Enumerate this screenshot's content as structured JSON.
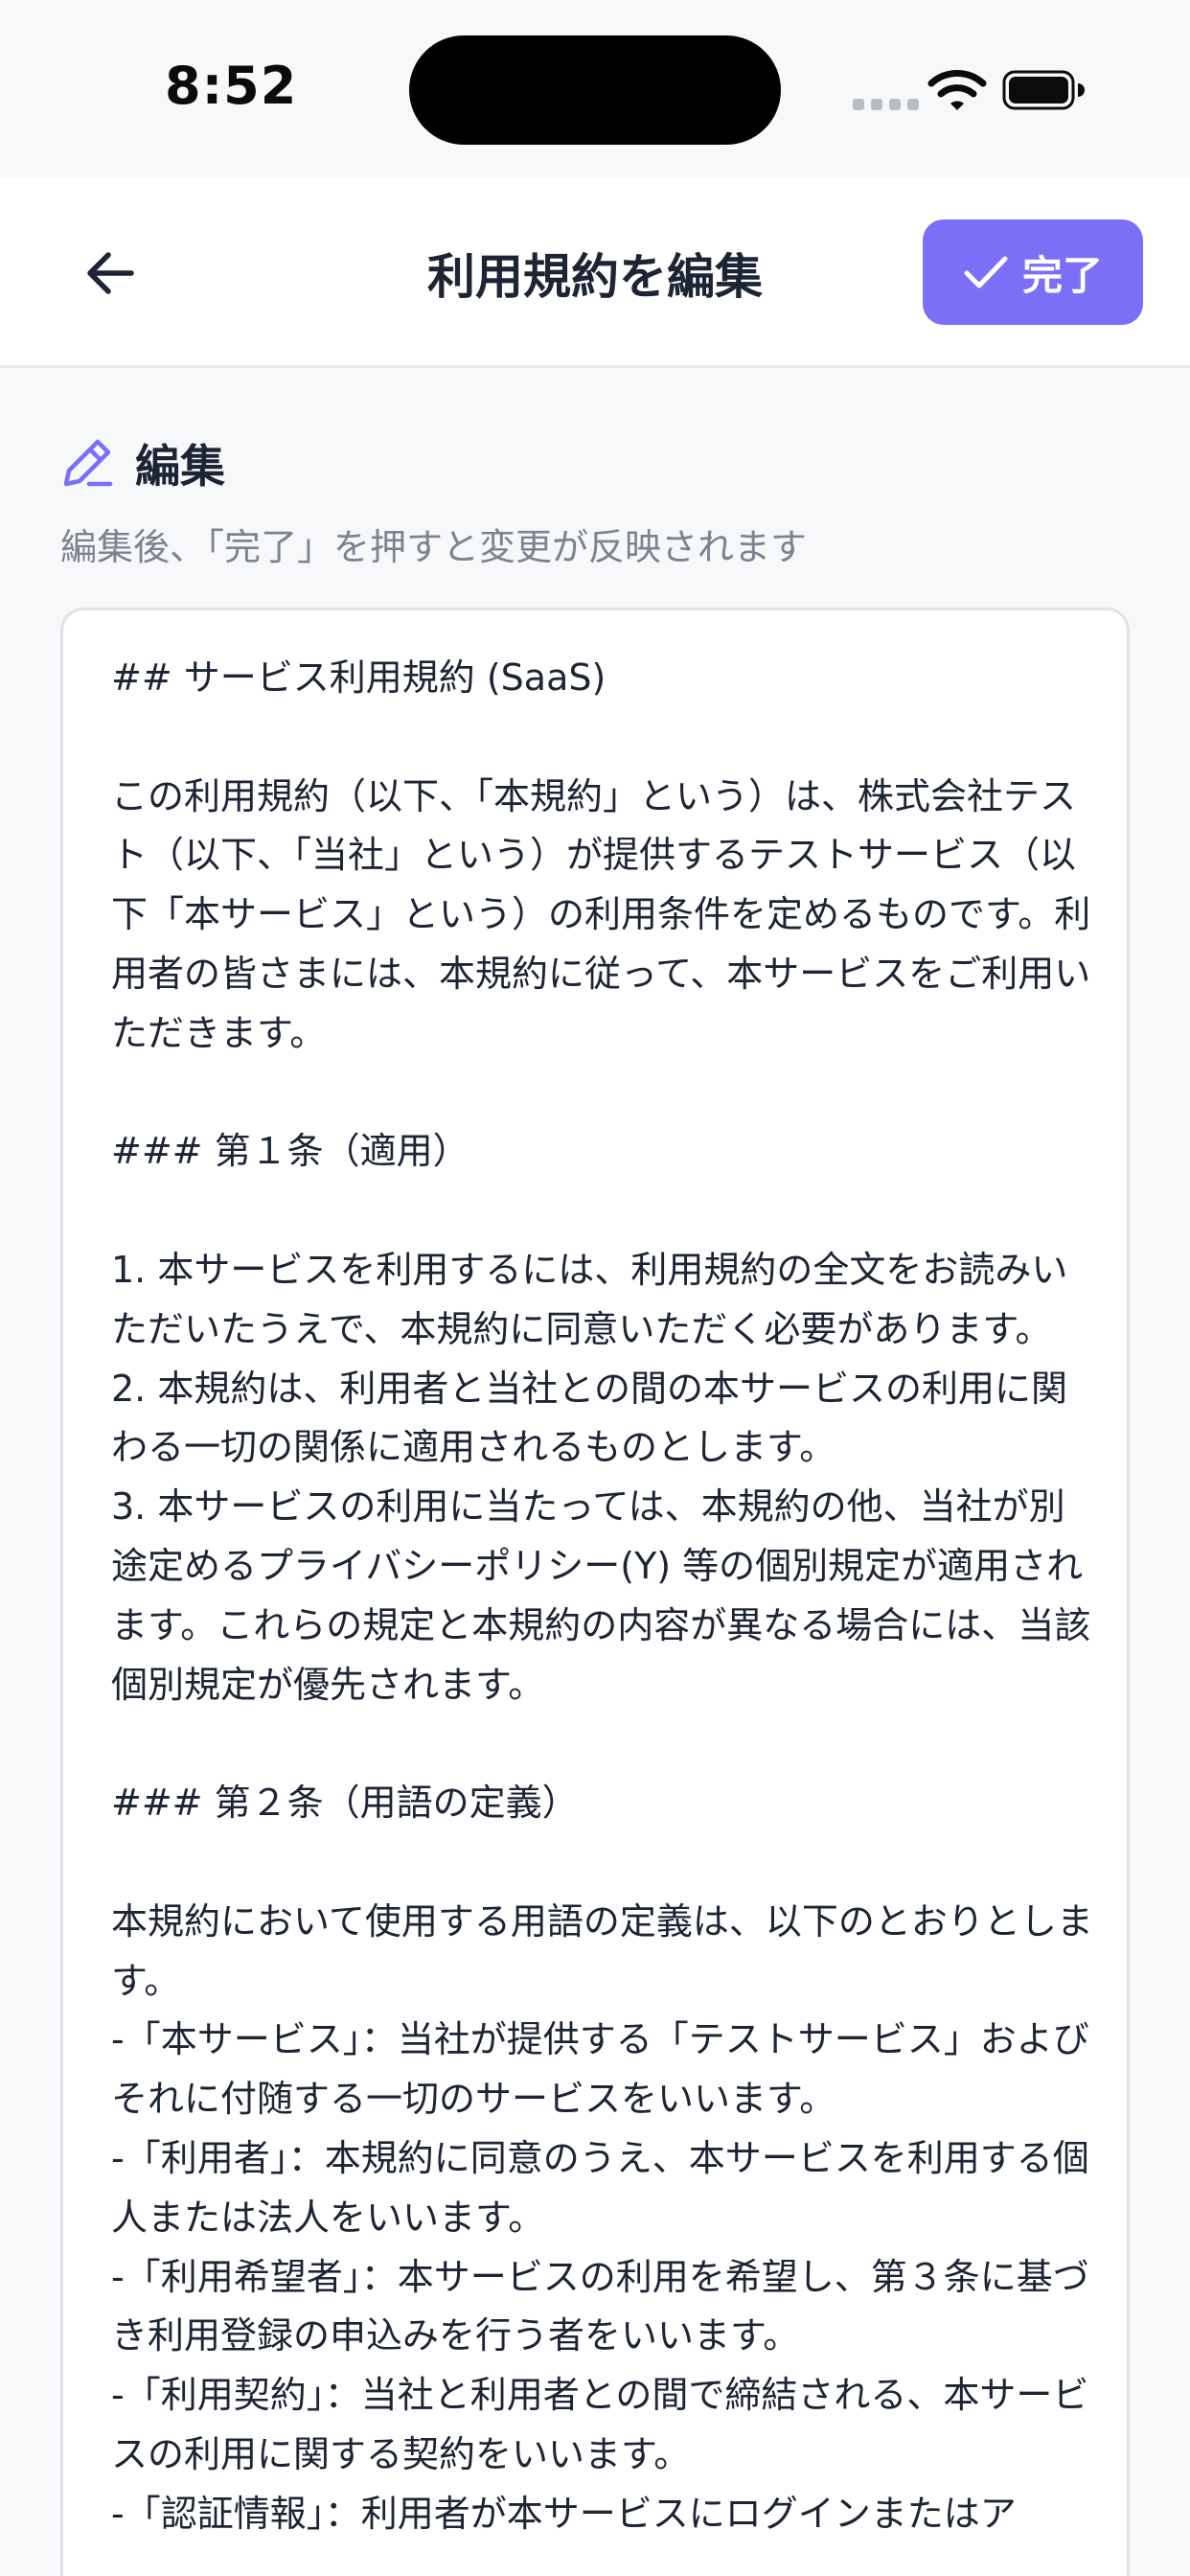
{
  "status_bar": {
    "time": "8:52"
  },
  "header": {
    "title": "利用規約を編集",
    "done_label": "完了"
  },
  "section": {
    "title": "編集",
    "hint": "編集後、「完了」を押すと変更が反映されます"
  },
  "editor": {
    "content": "## サービス利用規約 (SaaS)\n\nこの利用規約（以下、「本規約」という）は、株式会社テスト（以下、「当社」という）が提供するテストサービス（以下「本サービス」という）の利用条件を定めるものです。利用者の皆さまには、本規約に従って、本サービスをご利用いただきます。\n\n### 第１条（適用）\n\n1. 本サービスを利用するには、利用規約の全文をお読みいただいたうえで、本規約に同意いただく必要があります。\n2. 本規約は、利用者と当社との間の本サービスの利用に関わる一切の関係に適用されるものとします。\n3. 本サービスの利用に当たっては、本規約の他、当社が別途定めるプライバシーポリシー(Y) 等の個別規定が適用されます。これらの規定と本規約の内容が異なる場合には、当該個別規定が優先されます。\n\n### 第２条（用語の定義）\n\n本規約において使用する用語の定義は、以下のとおりとします。\n-「本サービス」：当社が提供する「テストサービス」およびそれに付随する一切のサービスをいいます。\n-「利用者」：本規約に同意のうえ、本サービスを利用する個人または法人をいいます。\n-「利用希望者」：本サービスの利用を希望し、第３条に基づき利用登録の申込みを行う者をいいます。\n-「利用契約」：当社と利用者との間で締結される、本サービスの利用に関する契約をいいます。\n-「認証情報」：利用者が本サービスにログインまたはア"
  },
  "colors": {
    "accent": "#7b6ff7",
    "background": "#f7f8fa",
    "text": "#1d2433",
    "muted": "#7c838f"
  },
  "icons": {
    "back": "arrow-left-icon",
    "done": "check-icon",
    "section": "pencil-icon"
  }
}
